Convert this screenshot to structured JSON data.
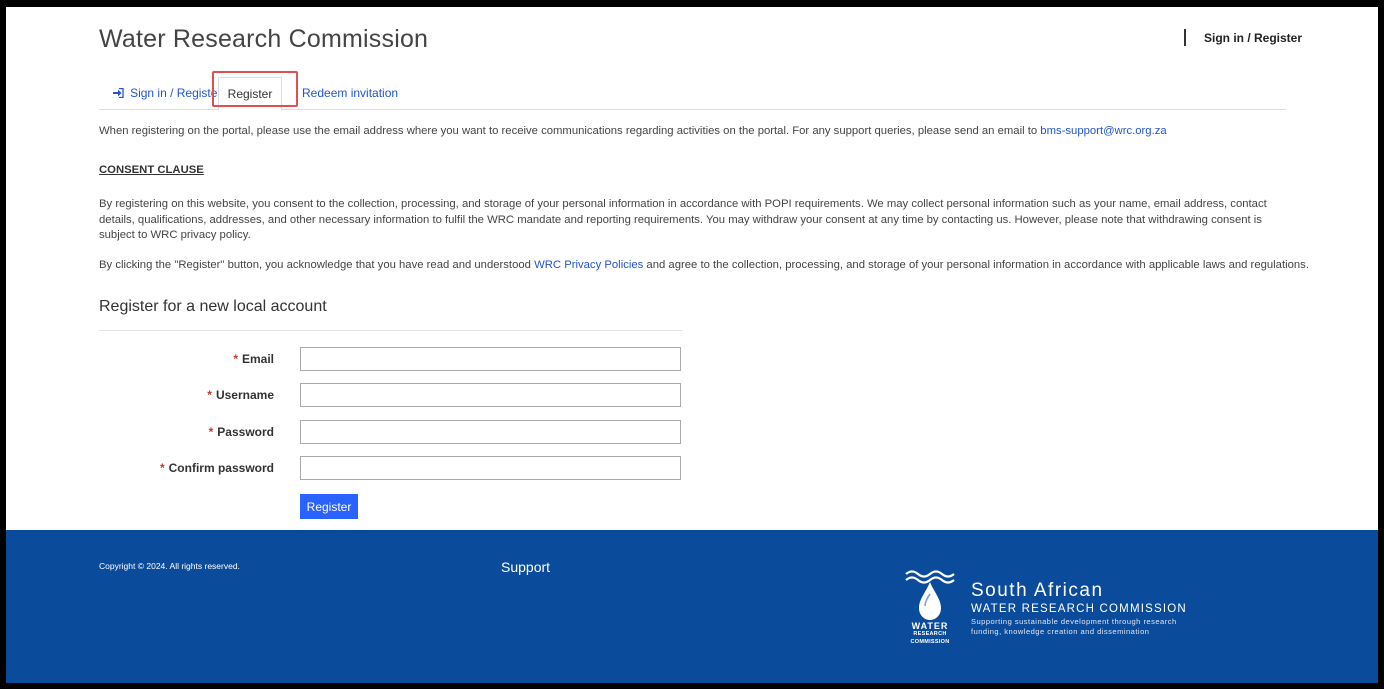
{
  "header": {
    "brand": "Water Research Commission",
    "signin_link": "Sign in / Register"
  },
  "tabs": [
    {
      "label": "Sign in / Register",
      "icon": "sign-in-icon"
    },
    {
      "label": "Register"
    },
    {
      "label": "Redeem invitation"
    }
  ],
  "intro": {
    "text": "When registering on the portal, please use the email address where you want to receive communications regarding activities on the portal. For any support queries, please send an email to ",
    "email": "bms-support@wrc.org.za"
  },
  "consent": {
    "title": "CONSENT CLAUSE",
    "body": "By registering on this website, you consent to the collection, processing, and storage of your personal information in accordance with POPI requirements. We may collect personal information such as your name, email address, contact details, qualifications, addresses, and other necessary information to fulfil the WRC mandate and reporting requirements. You may withdraw your consent at any time by contacting us. However, please note that withdrawing consent is subject to WRC privacy policy.",
    "ack_before": "By clicking the \"Register\" button, you acknowledge that you have read and understood ",
    "ack_link": "WRC Privacy Policies",
    "ack_after": " and agree to the collection, processing, and storage of your personal information in accordance with applicable laws and regulations."
  },
  "form": {
    "title": "Register for a new local account",
    "required_marker": "*",
    "fields": [
      {
        "label": "Email",
        "value": ""
      },
      {
        "label": "Username",
        "value": ""
      },
      {
        "label": "Password",
        "value": ""
      },
      {
        "label": "Confirm password",
        "value": ""
      }
    ],
    "submit_label": "Register"
  },
  "footer": {
    "copyright": "Copyright © 2024. All rights reserved.",
    "support": "Support",
    "logo": {
      "line1": "South African",
      "line2": "WATER RESEARCH COMMISSION",
      "line3a": "Supporting sustainable development through research",
      "line3b": "funding, knowledge creation and dissemination",
      "mark_word": "WATER",
      "mark_sub1": "RESEARCH",
      "mark_sub2": "COMMISSION"
    }
  },
  "colors": {
    "footer_bg": "#0b4b9b",
    "link": "#2255cc",
    "button": "#2962ff",
    "highlight": "#e05050"
  }
}
